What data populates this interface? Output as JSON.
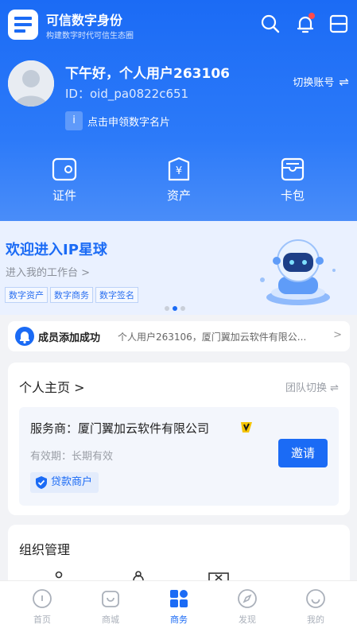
{
  "app": {
    "title": "可信数字身份",
    "subtitle": "构建数字时代可信生态圈"
  },
  "user": {
    "greeting": "下午好，个人用户263106",
    "oid": "ID：oid_pa0822c651",
    "card_link": "点击申领数字名片",
    "card_icon_letter": "i"
  },
  "header": {
    "switch_account": "切换账号",
    "switch_icon": "⇌"
  },
  "quick": [
    {
      "label": "证件",
      "icon": "id-card-icon"
    },
    {
      "label": "资产",
      "icon": "yuan-asset-icon"
    },
    {
      "label": "卡包",
      "icon": "wallet-icon"
    }
  ],
  "banner": {
    "title": "欢迎进入IP星球",
    "subtitle": "进入我的工作台 >",
    "tags": [
      "数字资产",
      "数字商务",
      "数字签名"
    ],
    "carousel_active": 2
  },
  "notice": {
    "title": "成员添加成功",
    "text": "个人用户263106，厦门翼加云软件有限公...",
    "chevron": ">"
  },
  "home": {
    "title": "个人主页 >",
    "team_switch": "团队切换 ⇌",
    "provider": "服务商：厦门翼加云软件有限公司",
    "validity": "有效期：长期有效",
    "badge": "贷款商户",
    "invite": "邀请"
  },
  "org": {
    "title": "组织管理"
  },
  "tabs": [
    {
      "label": "首页",
      "icon": "home-icon",
      "active": false
    },
    {
      "label": "商城",
      "icon": "shop-icon",
      "active": false
    },
    {
      "label": "商务",
      "icon": "business-icon",
      "active": true
    },
    {
      "label": "发现",
      "icon": "compass-icon",
      "active": false
    },
    {
      "label": "我的",
      "icon": "profile-icon",
      "active": false
    }
  ],
  "colors": {
    "primary": "#1b6bf5",
    "alert": "#ff4b4b"
  }
}
